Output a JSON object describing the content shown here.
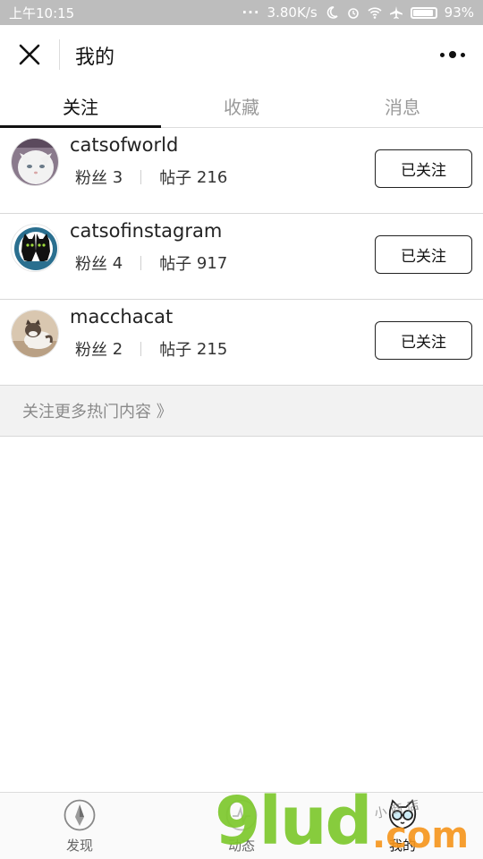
{
  "status_bar": {
    "time": "上午10:15",
    "net_speed": "3.80K/s",
    "battery": "93%",
    "battery_level": 0.93,
    "dots": "···"
  },
  "header": {
    "title": "我的",
    "close_icon": "close-icon",
    "more_icon": "more-dots-icon"
  },
  "tabs": [
    {
      "label": "关注",
      "active": true
    },
    {
      "label": "收藏",
      "active": false
    },
    {
      "label": "消息",
      "active": false
    }
  ],
  "follows": [
    {
      "name": "catsofworld",
      "fans_label": "粉丝",
      "fans": "3",
      "posts_label": "帖子",
      "posts": "216",
      "button": "已关注",
      "avatar": "white-cat-avatar"
    },
    {
      "name": "catsofinstagram",
      "fans_label": "粉丝",
      "fans": "4",
      "posts_label": "帖子",
      "posts": "917",
      "button": "已关注",
      "avatar": "black-cats-logo-avatar"
    },
    {
      "name": "macchacat",
      "fans_label": "粉丝",
      "fans": "2",
      "posts_label": "帖子",
      "posts": "215",
      "button": "已关注",
      "avatar": "tabby-cat-avatar"
    }
  ],
  "more_hot": "关注更多热门内容 》",
  "bottom_nav": [
    {
      "label": "发现",
      "icon": "compass-icon",
      "active": false
    },
    {
      "label": "动态",
      "icon": "activity-icon",
      "active": false
    },
    {
      "label": "我的",
      "icon": "cat-glasses-icon",
      "active": true
    }
  ],
  "watermark": {
    "main": "9lud",
    "suffix": ".com",
    "script": "小 商 店"
  },
  "colors": {
    "status_bar_bg": "#bdbdbd",
    "watermark_green": "#7dc82d",
    "watermark_orange": "#f5961e"
  }
}
